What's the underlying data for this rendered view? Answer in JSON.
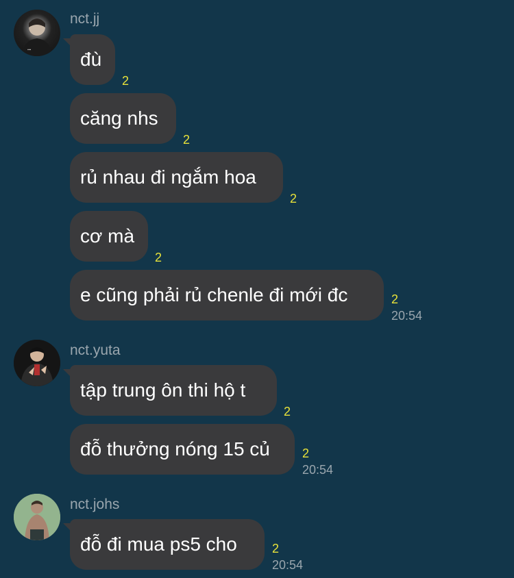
{
  "groups": [
    {
      "sender": "nct.jj",
      "messages": [
        {
          "text": "đù",
          "read": "2"
        },
        {
          "text": "căng nhs",
          "read": "2"
        },
        {
          "text": "rủ nhau đi ngắm hoa",
          "read": "2"
        },
        {
          "text": "cơ mà",
          "read": "2"
        },
        {
          "text": "e cũng phải rủ chenle đi mới đc",
          "read": "2",
          "time": "20:54"
        }
      ]
    },
    {
      "sender": "nct.yuta",
      "messages": [
        {
          "text": "tập trung ôn thi hộ t",
          "read": "2"
        },
        {
          "text": "đỗ thưởng nóng 15 củ",
          "read": "2",
          "time": "20:54"
        }
      ]
    },
    {
      "sender": "nct.johs",
      "messages": [
        {
          "text": "đỗ đi mua ps5 cho",
          "read": "2",
          "time": "20:54"
        }
      ]
    }
  ],
  "colors": {
    "background": "#12364a",
    "bubble": "#3a3a3c",
    "read_count": "#e8e23a",
    "meta_text": "#9aa6ae"
  }
}
